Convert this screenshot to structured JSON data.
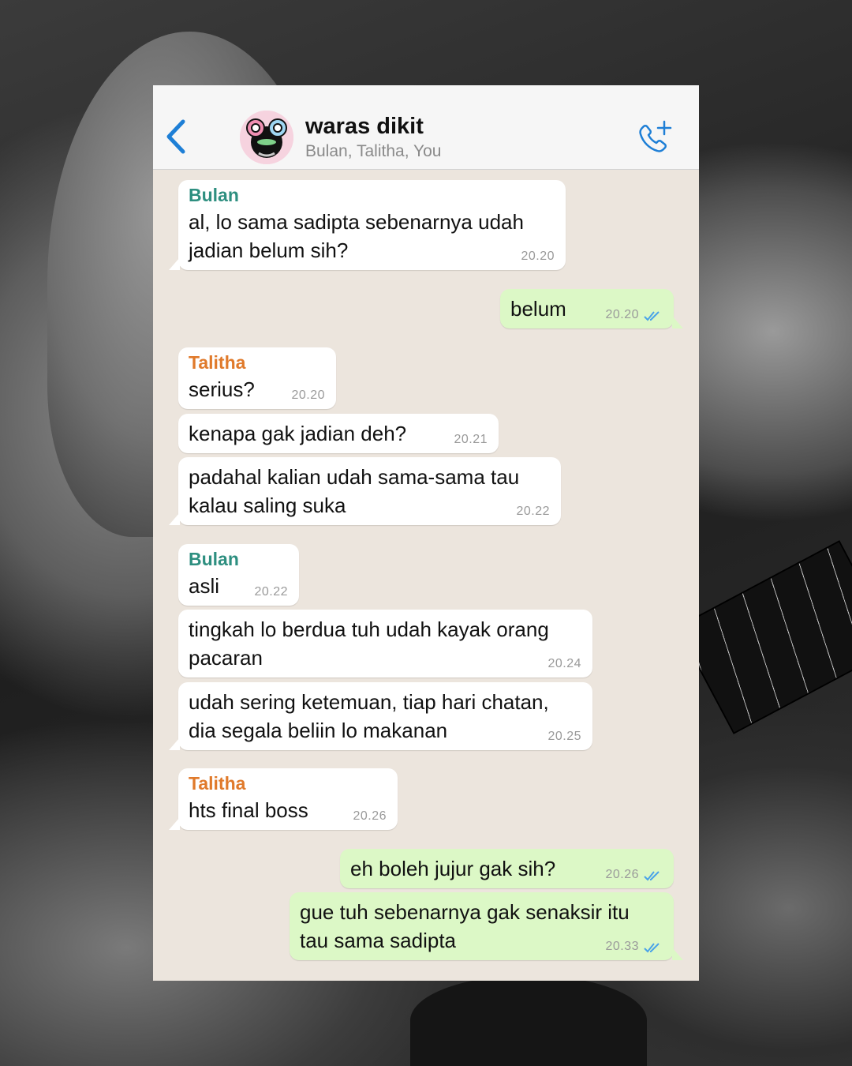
{
  "chat": {
    "title": "waras dikit",
    "members": "Bulan, Talitha, You"
  },
  "colors": {
    "sender_bulan": "#2e8f80",
    "sender_talitha": "#e07a2b",
    "outgoing_bubble": "#dcf8c6",
    "incoming_bubble": "#ffffff",
    "accent": "#1e7fd6",
    "read_ticks": "#4aa3e8"
  },
  "icons": [
    "back-chevron-icon",
    "group-avatar",
    "add-call-icon",
    "read-receipt-icon"
  ],
  "messages": [
    {
      "sender": "Bulan",
      "line1": "al, lo sama sadipta sebenarnya udah",
      "line2": "jadian belum sih?",
      "time": "20.20"
    },
    {
      "sender": "",
      "line1": "belum",
      "line2": "",
      "time": "20.20"
    },
    {
      "sender": "Talitha",
      "line1": "serius?",
      "line2": "",
      "time": "20.20"
    },
    {
      "sender": "",
      "line1": "kenapa gak jadian deh?",
      "line2": "",
      "time": "20.21"
    },
    {
      "sender": "",
      "line1": "padahal kalian udah sama-sama tau",
      "line2": "kalau saling suka",
      "time": "20.22"
    },
    {
      "sender": "Bulan",
      "line1": "asli",
      "line2": "",
      "time": "20.22"
    },
    {
      "sender": "",
      "line1": "tingkah lo berdua tuh udah kayak orang",
      "line2": "pacaran",
      "time": "20.24"
    },
    {
      "sender": "",
      "line1": "udah sering ketemuan, tiap hari chatan,",
      "line2": "dia segala beliin lo makanan",
      "time": "20.25"
    },
    {
      "sender": "Talitha",
      "line1": "hts final boss",
      "line2": "",
      "time": "20.26"
    },
    {
      "sender": "",
      "line1": "eh boleh jujur gak sih?",
      "line2": "",
      "time": "20.26"
    },
    {
      "sender": "",
      "line1": "gue tuh sebenarnya gak senaksir itu",
      "line2": "tau sama sadipta",
      "time": "20.33"
    }
  ]
}
